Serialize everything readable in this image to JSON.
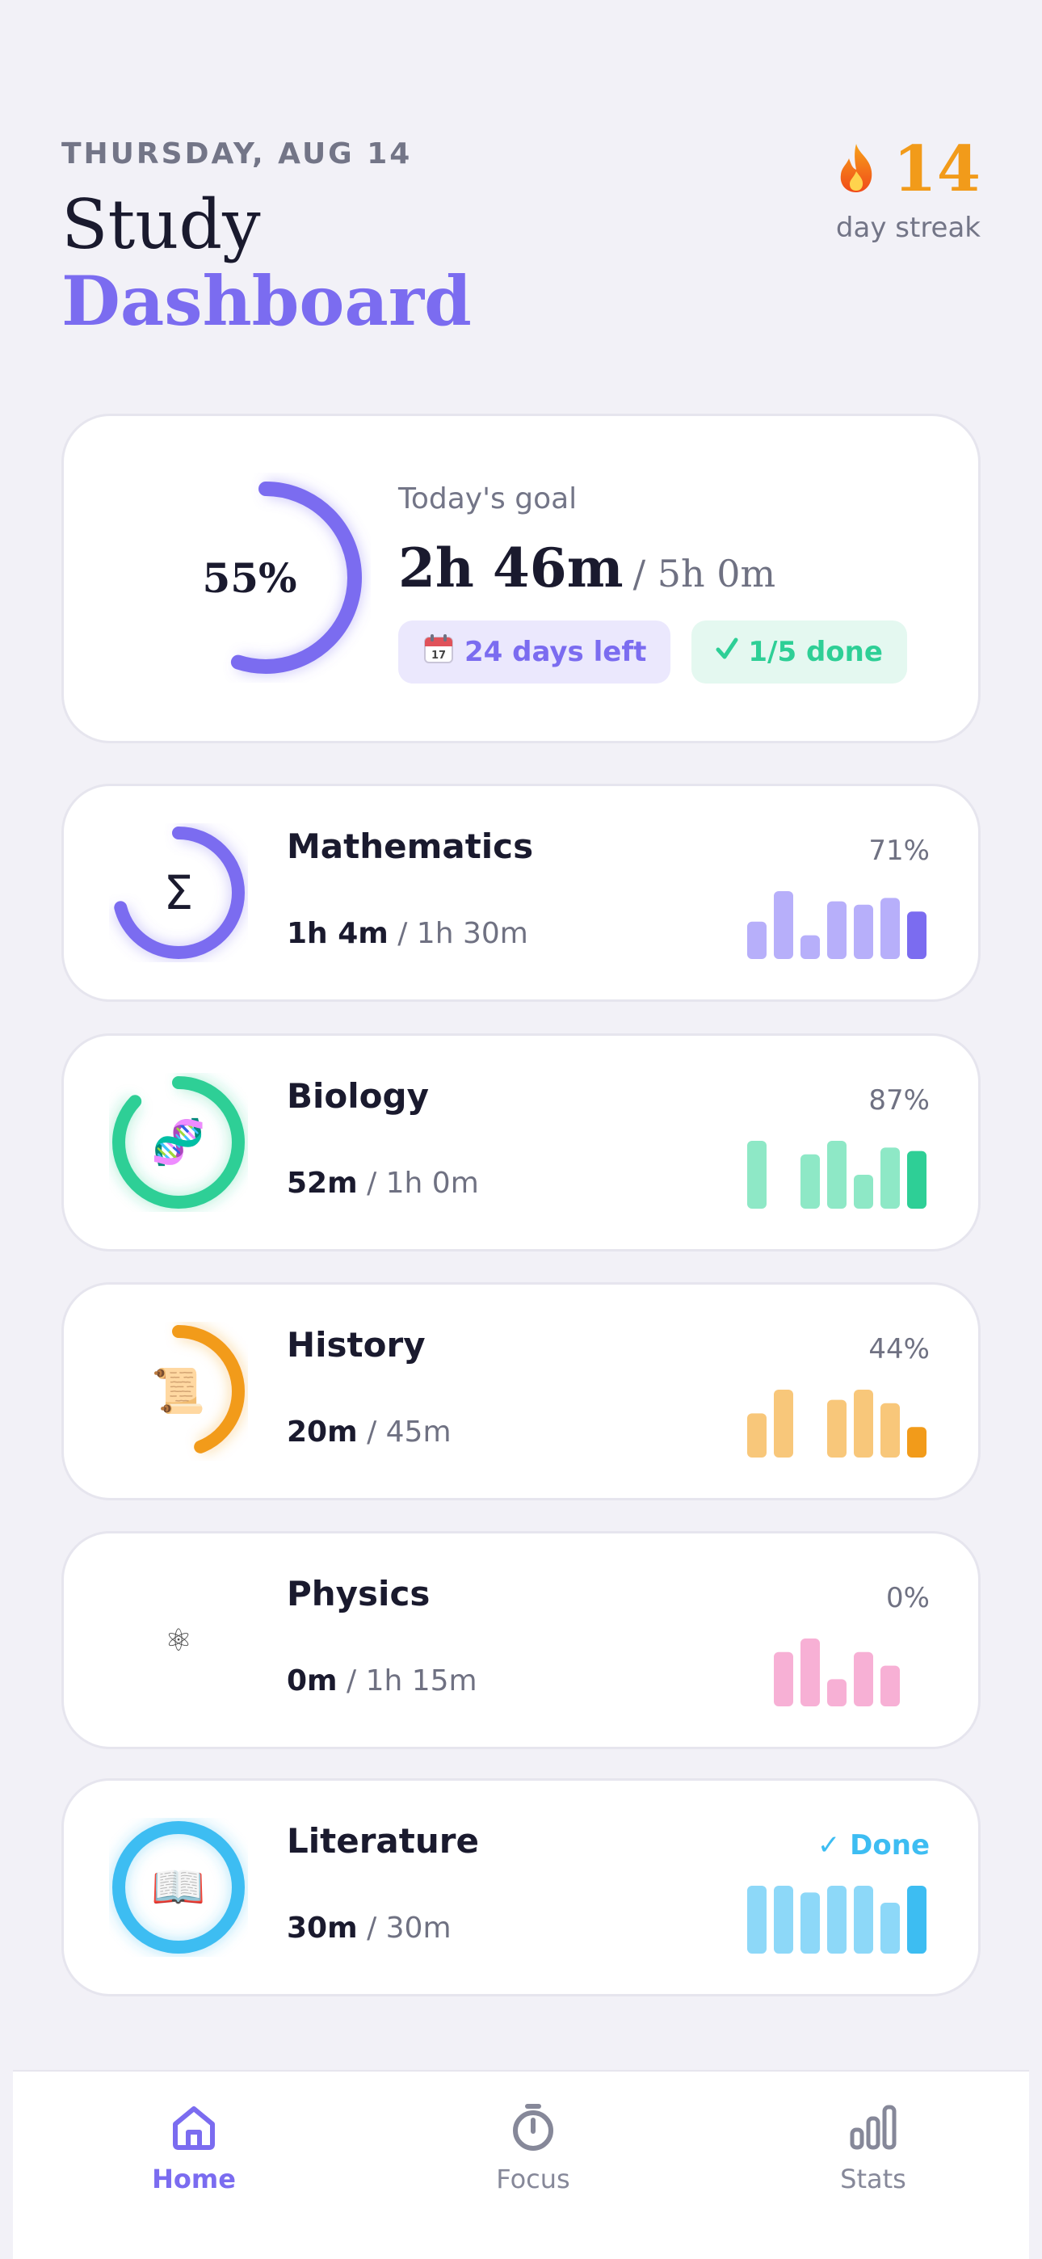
{
  "header": {
    "date": "THURSDAY, AUG 14",
    "title_line1": "Study",
    "title_line2": "Dashboard",
    "streak_icon": "fire-icon",
    "streak_count": "14",
    "streak_label": "day streak"
  },
  "goal": {
    "percent_label": "55%",
    "progress": 0.55,
    "label": "Today's goal",
    "studied": "2h 46m",
    "target": "/ 5h 0m",
    "days_left_icon": "calendar-icon",
    "days_left": "24 days left",
    "done_icon": "check-icon",
    "done_count": "1/5 done",
    "accent": "#7b6cf0"
  },
  "subjects": [
    {
      "name": "Mathematics",
      "icon": "sigma-icon",
      "glyph": "Σ",
      "studied": "1h 4m",
      "target": "/ 1h 30m",
      "status": "71%",
      "progress": 0.71,
      "color": "#7b6cf0",
      "bar_color": "#b7affa",
      "bars": [
        0.55,
        1.0,
        0.35,
        0.85,
        0.8,
        0.9,
        0.7
      ]
    },
    {
      "name": "Biology",
      "icon": "dna-icon",
      "glyph": "🧬",
      "studied": "52m",
      "target": "/ 1h 0m",
      "status": "87%",
      "progress": 0.87,
      "color": "#2ecf96",
      "bar_color": "#8ee8c6",
      "bars": [
        1.0,
        0,
        0.8,
        1.0,
        0.5,
        0.9,
        0.85
      ]
    },
    {
      "name": "History",
      "icon": "scroll-icon",
      "glyph": "📜",
      "studied": "20m",
      "target": "/ 45m",
      "status": "44%",
      "progress": 0.44,
      "color": "#f29b1a",
      "bar_color": "#f8c77a",
      "bars": [
        0.65,
        1.0,
        0,
        0.85,
        1.0,
        0.8,
        0.45
      ]
    },
    {
      "name": "Physics",
      "icon": "atom-icon",
      "glyph": "⚛",
      "studied": "0m",
      "target": "/ 1h 15m",
      "status": "0%",
      "progress": 0,
      "color": "#f07ab8",
      "bar_color": "#f7b0d5",
      "bars": [
        0,
        0.8,
        1.0,
        0.4,
        0.8,
        0.6,
        0
      ]
    },
    {
      "name": "Literature",
      "icon": "book-icon",
      "glyph": "📖",
      "studied": "30m",
      "target": "/ 30m",
      "status": "✓ Done",
      "progress": 1,
      "color": "#3dbdf2",
      "bar_color": "#8dd8f8",
      "bars": [
        1.0,
        1.0,
        0.9,
        1.0,
        1.0,
        0.75,
        1.0
      ]
    }
  ],
  "tabs": [
    {
      "label": "Home",
      "icon": "home-icon",
      "active": true
    },
    {
      "label": "Focus",
      "icon": "timer-icon",
      "active": false
    },
    {
      "label": "Stats",
      "icon": "bar-chart-icon",
      "active": false
    }
  ],
  "colors": {
    "background": "#f2f1f7",
    "muted": "#737587",
    "inactive_tab": "#868899"
  }
}
